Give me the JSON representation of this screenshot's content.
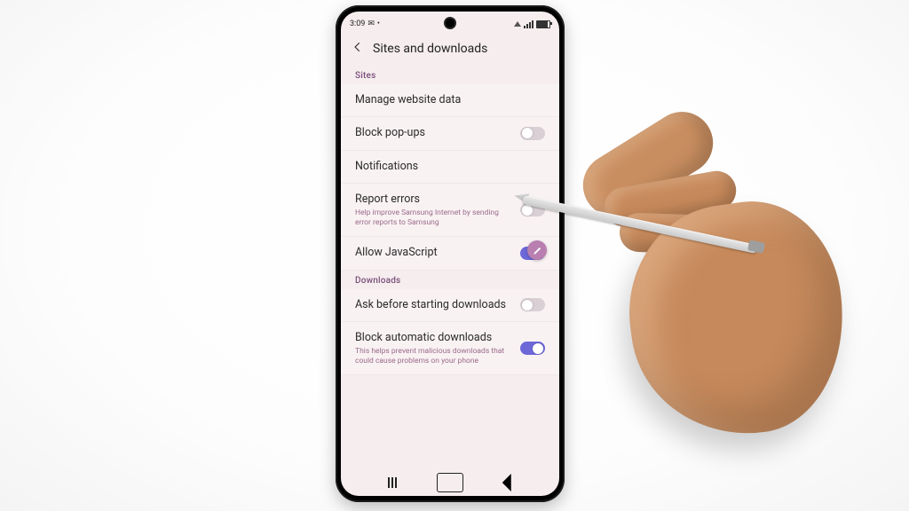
{
  "status": {
    "time": "3:09",
    "msg_icon": "message-icon",
    "other_icon": "app-icon"
  },
  "header": {
    "title": "Sites and downloads"
  },
  "sections": {
    "sites": {
      "label": "Sites"
    },
    "downloads": {
      "label": "Downloads"
    }
  },
  "rows": {
    "manage_data": {
      "title": "Manage website data"
    },
    "block_popups": {
      "title": "Block pop-ups",
      "toggle": "off"
    },
    "notifications": {
      "title": "Notifications"
    },
    "report_errors": {
      "title": "Report errors",
      "sub": "Help improve Samsung Internet by sending error reports to Samsung",
      "toggle": "off"
    },
    "allow_js": {
      "title": "Allow JavaScript",
      "toggle": "on"
    },
    "ask_dl": {
      "title": "Ask before starting downloads",
      "toggle": "off"
    },
    "block_auto_dl": {
      "title": "Block automatic downloads",
      "sub": "This helps prevent malicious downloads that could cause problems on your phone",
      "toggle": "on"
    }
  },
  "colors": {
    "accent": "#6c68d8",
    "tint": "#f6edee"
  }
}
